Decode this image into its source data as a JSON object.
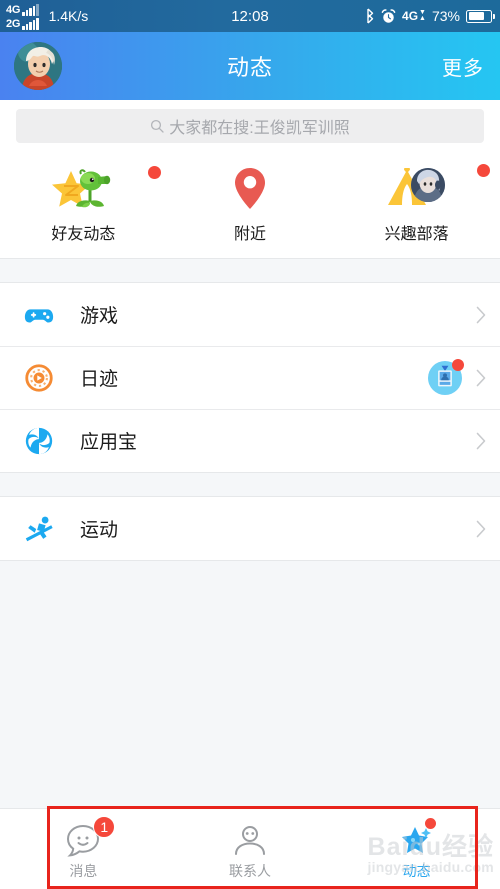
{
  "status_bar": {
    "sim1_network": "4G",
    "sim2_network": "2G",
    "network_speed": "1.4K/s",
    "time": "12:08",
    "bluetooth_icon": "bluetooth-icon",
    "alarm_icon": "alarm-clock-icon",
    "data_network": "4G",
    "battery_percent": "73%",
    "battery_level": 73
  },
  "header": {
    "title": "动态",
    "more_label": "更多",
    "avatar_name": "user-avatar",
    "gradient_from": "#4a82f0",
    "gradient_to": "#25c6f2"
  },
  "search": {
    "placeholder": "大家都在搜:王俊凯军训照",
    "icon": "search-icon"
  },
  "shortcuts": [
    {
      "label": "好友动态",
      "icon": "star-plant-icon",
      "badge": true
    },
    {
      "label": "附近",
      "icon": "map-pin-icon",
      "badge": false
    },
    {
      "label": "兴趣部落",
      "icon": "tent-icon",
      "badge": true
    }
  ],
  "sections": [
    {
      "rows": [
        {
          "label": "游戏",
          "icon": "gamepad-icon",
          "color": "#1ca9f0",
          "badge_avatar": false,
          "chevron": "chevron-right-icon"
        },
        {
          "label": "日迹",
          "icon": "play-circle-icon",
          "color": "#f58b34",
          "badge_avatar": true,
          "chevron": "chevron-right-icon"
        },
        {
          "label": "应用宝",
          "icon": "yingyongbao-icon",
          "color": "#1ca9f0",
          "badge_avatar": false,
          "chevron": "chevron-right-icon"
        }
      ]
    },
    {
      "rows": [
        {
          "label": "运动",
          "icon": "running-icon",
          "color": "#1ca9f0",
          "badge_avatar": false,
          "chevron": "chevron-right-icon"
        }
      ]
    }
  ],
  "tabbar": {
    "tabs": [
      {
        "label": "消息",
        "icon": "message-smiley-icon",
        "count": "1",
        "active": false
      },
      {
        "label": "联系人",
        "icon": "contacts-person-icon",
        "count": "",
        "active": false
      },
      {
        "label": "动态",
        "icon": "star-sparkle-icon",
        "count": "",
        "active": true,
        "dot": true
      }
    ],
    "active_color": "#2aa7ef",
    "inactive_color": "#9a9da1"
  },
  "highlight": {
    "color": "#e8241c"
  },
  "watermark": {
    "line1": "Baidu经验",
    "line2": "jingyan.baidu.com"
  }
}
